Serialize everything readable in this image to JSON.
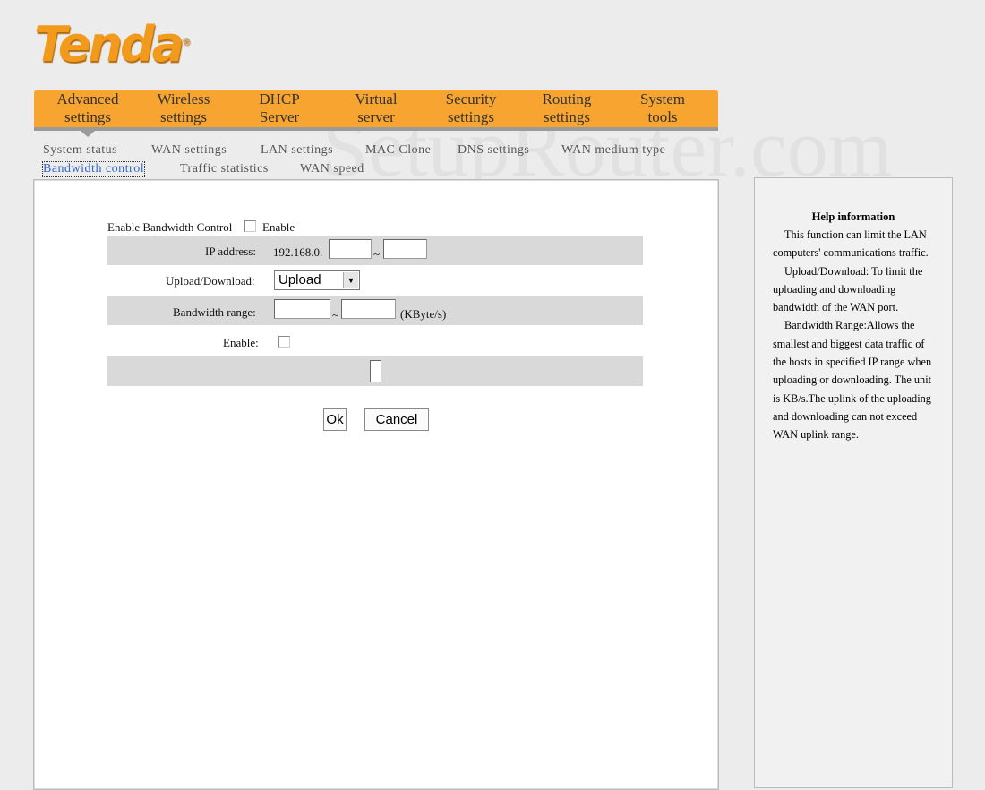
{
  "brand": {
    "logo": "Tenda",
    "watermark": "SetupRouter.com"
  },
  "nav": [
    "Advanced settings",
    "Wireless settings",
    "DHCP Server",
    "Virtual server",
    "Security settings",
    "Routing settings",
    "System tools"
  ],
  "nav_lines": [
    [
      "Advanced",
      "settings"
    ],
    [
      "Wireless",
      "settings"
    ],
    [
      "DHCP",
      "Server"
    ],
    [
      "Virtual",
      "server"
    ],
    [
      "Security",
      "settings"
    ],
    [
      "Routing",
      "settings"
    ],
    [
      "System",
      "tools"
    ]
  ],
  "subnav": [
    "System status",
    "WAN settings",
    "LAN settings",
    "MAC Clone",
    "DNS settings",
    "WAN medium type",
    "Bandwidth control",
    "Traffic statistics",
    "WAN speed"
  ],
  "active_subnav": "Bandwidth control",
  "form": {
    "enable_bw_label": "Enable Bandwidth Control",
    "enable_bw_text": "Enable",
    "enable_bw_checked": false,
    "ip_label": "IP address:",
    "ip_prefix": "192.168.0.",
    "ip_start": "",
    "ip_end": "",
    "tilde": "~",
    "updown_label": "Upload/Download:",
    "updown_value": "Upload",
    "bw_label": "Bandwidth range:",
    "bw_min": "",
    "bw_max": "",
    "bw_unit": "(KByte/s)",
    "enable_label": "Enable:",
    "enable_checked": false,
    "ok": "Ok",
    "cancel": "Cancel"
  },
  "help": {
    "title": "Help information",
    "paragraphs": [
      "This function can limit the LAN computers' communications traffic.",
      "Upload/Download: To limit the uploading and downloading bandwidth of the WAN port.",
      "Bandwidth Range:Allows the smallest and biggest data traffic of the hosts in specified IP range when uploading or downloading. The unit is KB/s.The uplink of the uploading and downloading can not exceed WAN uplink range."
    ]
  }
}
